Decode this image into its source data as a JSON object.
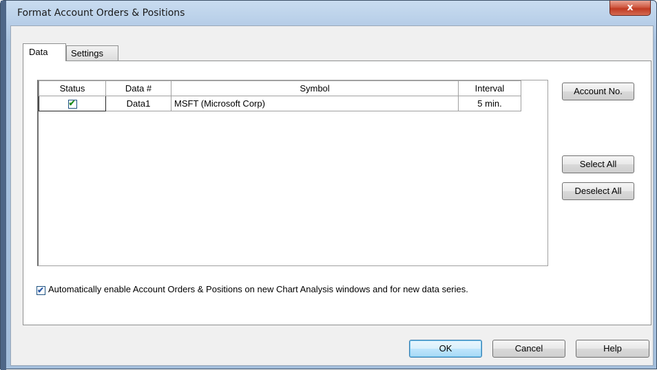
{
  "window": {
    "title": "Format Account Orders & Positions",
    "close_label": "x"
  },
  "tabs": [
    {
      "label": "Data",
      "active": true
    },
    {
      "label": "Settings",
      "active": false
    }
  ],
  "grid": {
    "columns": [
      "Status",
      "Data #",
      "Symbol",
      "Interval"
    ],
    "rows": [
      {
        "status_checked": true,
        "data": "Data1",
        "symbol": "MSFT (Microsoft Corp)",
        "interval": "5 min."
      }
    ]
  },
  "side_buttons": {
    "account_no": "Account No.",
    "select_all": "Select All",
    "deselect_all": "Deselect All"
  },
  "auto_enable": {
    "checked": true,
    "text": "Automatically enable Account Orders & Positions on new Chart Analysis windows and for new data series."
  },
  "footer": {
    "ok": "OK",
    "cancel": "Cancel",
    "help": "Help"
  },
  "colors": {
    "check_green": "#1c8a1c",
    "close_red": "#c03a22",
    "default_button_blue": "#3c7fb1"
  }
}
